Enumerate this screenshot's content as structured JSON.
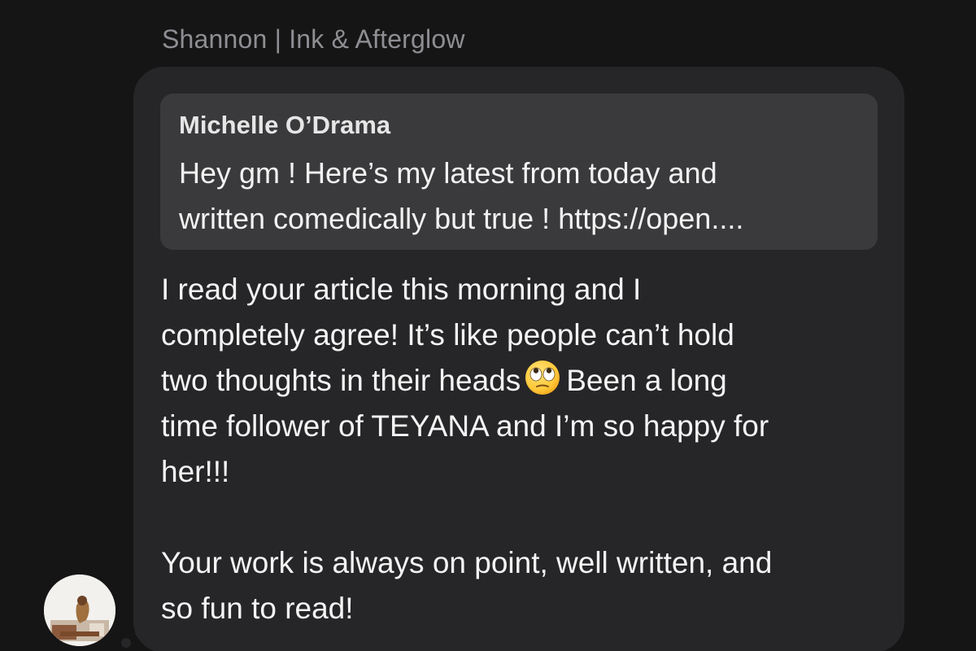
{
  "header": {
    "sender_name": "Shannon | Ink & Afterglow"
  },
  "quoted_message": {
    "author": "Michelle O’Drama",
    "lines": [
      "Hey gm ! Here’s my latest from today and",
      "written comedically but true ! https://open...."
    ]
  },
  "message": {
    "line_1": "I read your article this morning and I",
    "line_2": "completely agree! It’s like people can’t hold",
    "line_3_before_emoji": "two thoughts in their heads",
    "line_3_emoji": "face-with-rolling-eyes",
    "line_3_after_emoji": "Been a long",
    "line_4": "time follower of TEYANA and I’m so happy for",
    "line_5": "her!!!",
    "line_7": "Your work is always on point, well written, and",
    "line_8": "so fun to read!"
  },
  "colors": {
    "background": "#151515",
    "bubble": "#262628",
    "quote_bubble": "#3a3a3c",
    "sender_name": "#8e8e93",
    "text": "#f4f4f4"
  },
  "avatar": {
    "icon": "profile-photo"
  }
}
